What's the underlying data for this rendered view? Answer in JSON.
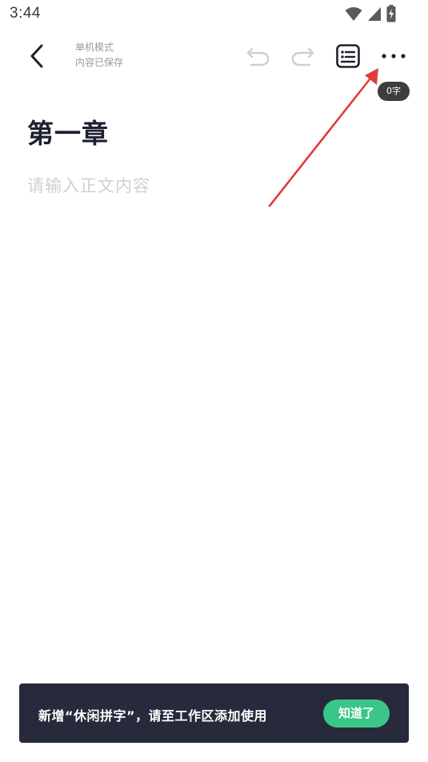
{
  "status_bar": {
    "time": "3:44",
    "icons": [
      "wifi-icon",
      "signal-icon",
      "battery-charging-icon"
    ]
  },
  "toolbar": {
    "mode_line1": "单机模式",
    "mode_line2": "内容已保存",
    "icons": [
      "back-icon",
      "undo-icon",
      "redo-icon",
      "outline-icon",
      "more-icon"
    ]
  },
  "word_count": "0字",
  "editor": {
    "chapter_title": "第一章",
    "body_placeholder": "请输入正文内容"
  },
  "toast": {
    "message": "新增“休闲拼字”，请至工作区添加使用",
    "button_label": "知道了"
  },
  "colors": {
    "annotation_arrow": "#e03c3c",
    "toast_bg": "#262a3a",
    "toast_button": "#39c686",
    "disabled_icon": "#cfcfcf"
  }
}
